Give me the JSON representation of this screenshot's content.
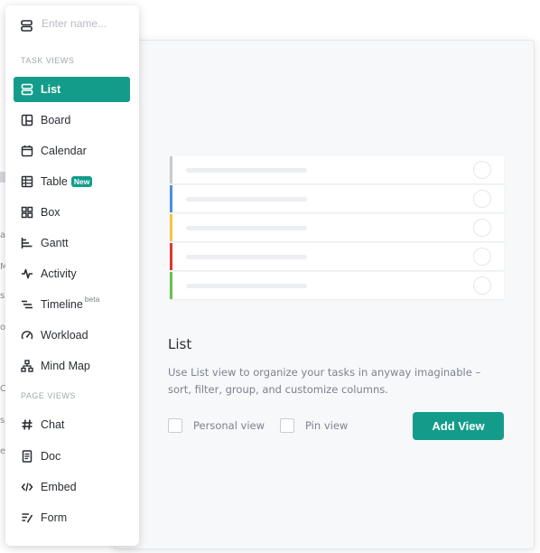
{
  "menu": {
    "name_placeholder": "Enter name...",
    "task_views_label": "TASK VIEWS",
    "page_views_label": "PAGE VIEWS",
    "task_views": [
      {
        "label": "List",
        "icon": "list-icon",
        "active": true
      },
      {
        "label": "Board",
        "icon": "board-icon"
      },
      {
        "label": "Calendar",
        "icon": "calendar-icon"
      },
      {
        "label": "Table",
        "icon": "table-icon",
        "badge": "New"
      },
      {
        "label": "Box",
        "icon": "box-icon"
      },
      {
        "label": "Gantt",
        "icon": "gantt-icon"
      },
      {
        "label": "Activity",
        "icon": "activity-icon"
      },
      {
        "label": "Timeline",
        "icon": "timeline-icon",
        "sup": "beta"
      },
      {
        "label": "Workload",
        "icon": "workload-icon"
      },
      {
        "label": "Mind Map",
        "icon": "mind-map-icon"
      }
    ],
    "page_views": [
      {
        "label": "Chat",
        "icon": "chat-icon"
      },
      {
        "label": "Doc",
        "icon": "doc-icon"
      },
      {
        "label": "Embed",
        "icon": "embed-icon"
      },
      {
        "label": "Form",
        "icon": "form-icon"
      }
    ]
  },
  "preview": {
    "title": "List",
    "description": "Use List view to organize your tasks in anyway imaginable – sort, filter, group, and customize columns.",
    "personal_view_label": "Personal view",
    "pin_view_label": "Pin view",
    "add_view_label": "Add View",
    "row_colors": [
      "#c7cacf",
      "#4a90e2",
      "#f5c542",
      "#d93a2b",
      "#6cc04a"
    ]
  },
  "colors": {
    "accent": "#149c8b"
  }
}
